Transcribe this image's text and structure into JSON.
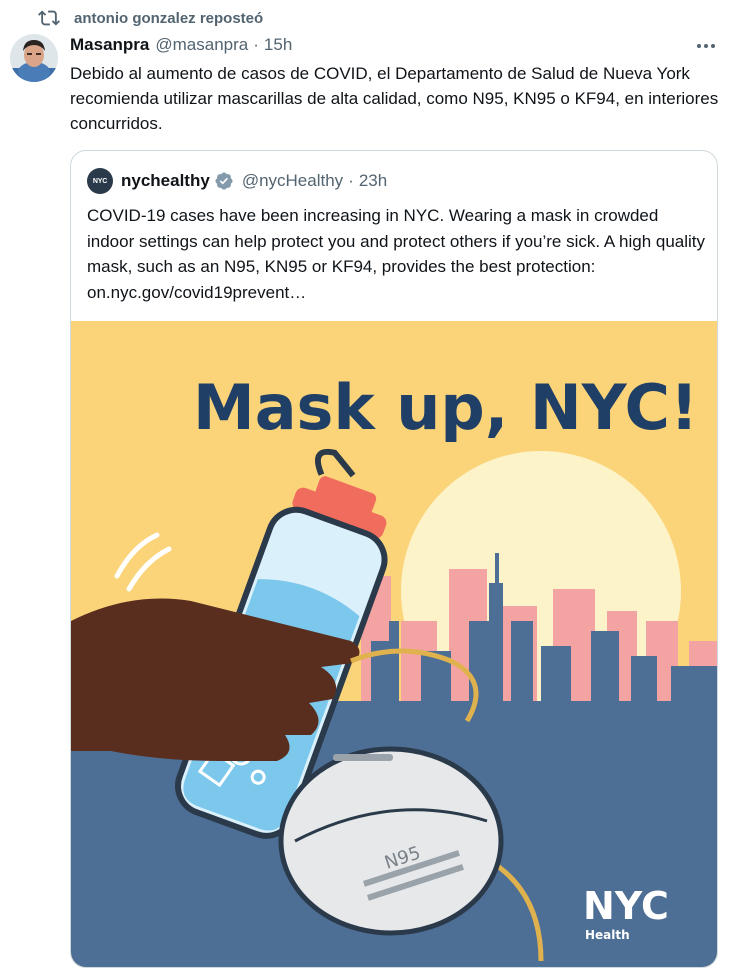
{
  "repost": {
    "label": "antonio gonzalez reposteó",
    "icon": "repost-icon"
  },
  "tweet": {
    "display_name": "Masanpra",
    "handle": "@masanpra",
    "separator": "·",
    "time": "15h",
    "more_icon": "more-dots-icon",
    "text": "Debido al aumento de casos de COVID, el Departamento de Salud de Nueva York recomienda utilizar mascarillas de alta calidad, como N95, KN95 o KF94, en interiores concurridos."
  },
  "quote": {
    "avatar_text": "NYC",
    "display_name": "nychealthy",
    "verified_icon": "verified-badge-icon",
    "handle": "@nycHealthy",
    "separator": "·",
    "time": "23h",
    "text": "COVID-19 cases have been increasing in NYC. Wearing a mask in crowded indoor settings can help protect you and protect others if you’re sick. A high quality mask, such as an N95, KN95 or KF94, provides the best protection: on.nyc.gov/covid19prevent…",
    "image": {
      "headline": "Mask up, NYC!",
      "mask_label": "N95",
      "logo_text": "NYC",
      "logo_subtext": "Health"
    }
  },
  "colors": {
    "secondary_text": "#536471",
    "primary_text": "#0f1419",
    "border": "#cfd9de",
    "verified": "#829aab",
    "poster_yellow": "#fbd47a",
    "poster_navy": "#1f3f66",
    "skyline_pink": "#f4a3a3",
    "skyline_blue": "#4d6e95"
  }
}
